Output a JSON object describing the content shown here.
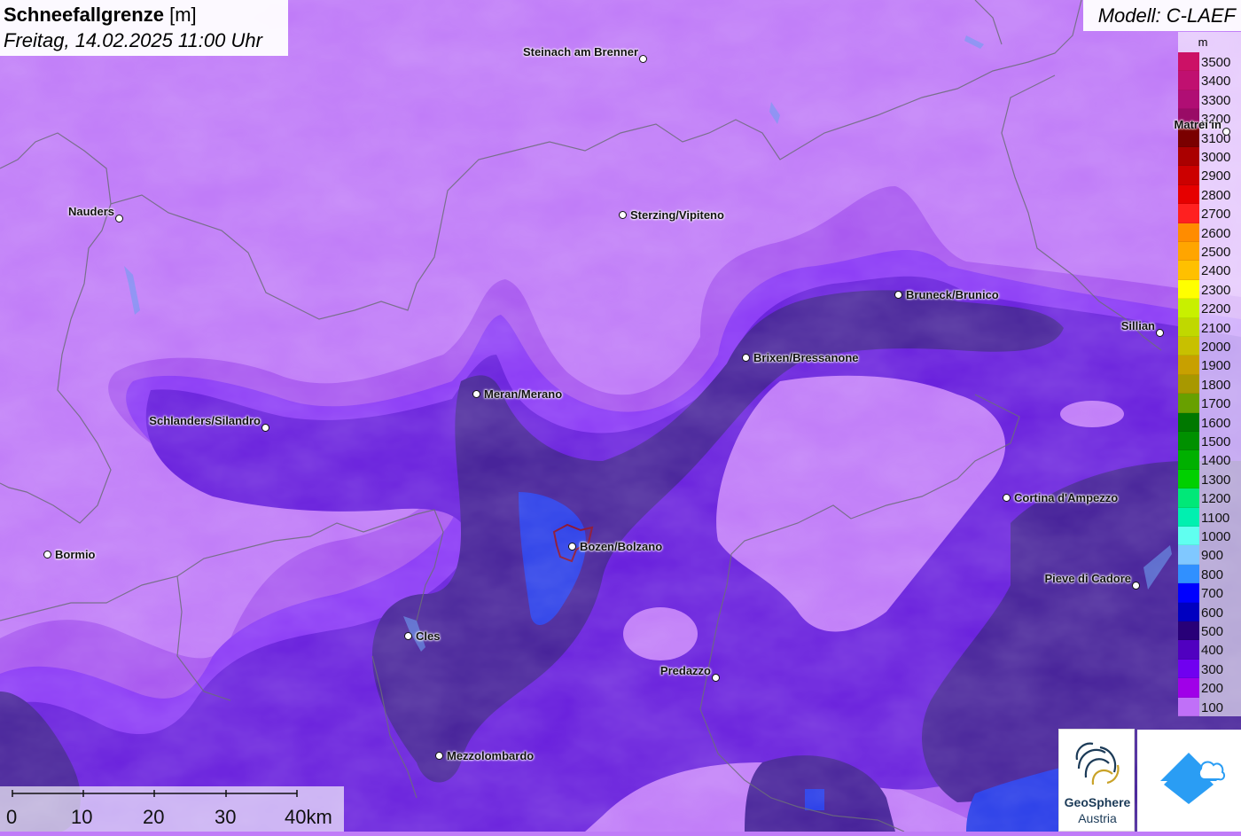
{
  "title": {
    "main": "Schneefallgrenze",
    "unit": "[m]",
    "subtitle": "Freitag, 14.02.2025 11:00 Uhr"
  },
  "model": "Modell: C-LAEF",
  "legend": {
    "unit": "m",
    "levels": [
      {
        "label": "3500",
        "color": "#cc1166"
      },
      {
        "label": "3400",
        "color": "#c01070"
      },
      {
        "label": "3300",
        "color": "#b00e74"
      },
      {
        "label": "3200",
        "color": "#990b66"
      },
      {
        "label": "3100",
        "color": "#7a0000"
      },
      {
        "label": "3000",
        "color": "#aa0000"
      },
      {
        "label": "2900",
        "color": "#cc0000"
      },
      {
        "label": "2800",
        "color": "#e60000"
      },
      {
        "label": "2700",
        "color": "#ff2020"
      },
      {
        "label": "2600",
        "color": "#ff8c00"
      },
      {
        "label": "2500",
        "color": "#ffa500"
      },
      {
        "label": "2400",
        "color": "#ffc000"
      },
      {
        "label": "2300",
        "color": "#ffff00"
      },
      {
        "label": "2200",
        "color": "#c8f000"
      },
      {
        "label": "2100",
        "color": "#c0d800"
      },
      {
        "label": "2000",
        "color": "#c8c000"
      },
      {
        "label": "1900",
        "color": "#c8a000"
      },
      {
        "label": "1800",
        "color": "#a89800"
      },
      {
        "label": "1700",
        "color": "#68a000"
      },
      {
        "label": "1600",
        "color": "#007800"
      },
      {
        "label": "1500",
        "color": "#009000"
      },
      {
        "label": "1400",
        "color": "#00b000"
      },
      {
        "label": "1300",
        "color": "#00d000"
      },
      {
        "label": "1200",
        "color": "#00e878"
      },
      {
        "label": "1100",
        "color": "#00f0b0"
      },
      {
        "label": "1000",
        "color": "#60fff0"
      },
      {
        "label": "900",
        "color": "#80c8ff"
      },
      {
        "label": "800",
        "color": "#3090ff"
      },
      {
        "label": "700",
        "color": "#0000ff"
      },
      {
        "label": "600",
        "color": "#0000c0"
      },
      {
        "label": "500",
        "color": "#280078"
      },
      {
        "label": "400",
        "color": "#5000c0"
      },
      {
        "label": "300",
        "color": "#7000f0"
      },
      {
        "label": "200",
        "color": "#a000e8"
      },
      {
        "label": "100",
        "color": "#c070f8"
      }
    ]
  },
  "cities": [
    {
      "name": "Steinach am Brenner",
      "label_side": "left"
    },
    {
      "name": "Nauders",
      "label_side": "left"
    },
    {
      "name": "Sterzing/Vipiteno",
      "label_side": "right"
    },
    {
      "name": "Matrei in",
      "label_side": "left"
    },
    {
      "name": "Bruneck/Brunico",
      "label_side": "right"
    },
    {
      "name": "Sillian",
      "label_side": "left"
    },
    {
      "name": "Brixen/Bressanone",
      "label_side": "right"
    },
    {
      "name": "Meran/Merano",
      "label_side": "right"
    },
    {
      "name": "Schlanders/Silandro",
      "label_side": "left"
    },
    {
      "name": "Cortina d'Ampezzo",
      "label_side": "right"
    },
    {
      "name": "Bormio",
      "label_side": "right"
    },
    {
      "name": "Bozen/Bolzano",
      "label_side": "right"
    },
    {
      "name": "Pieve di Cadore",
      "label_side": "left"
    },
    {
      "name": "Cles",
      "label_side": "right"
    },
    {
      "name": "Predazzo",
      "label_side": "left"
    },
    {
      "name": "Mezzolombardo",
      "label_side": "right"
    }
  ],
  "scale": {
    "labels": [
      "0",
      "10",
      "20",
      "30",
      "40km"
    ]
  },
  "logos": {
    "geosphere_line1": "GeoSphere",
    "geosphere_line2": "Austria"
  }
}
